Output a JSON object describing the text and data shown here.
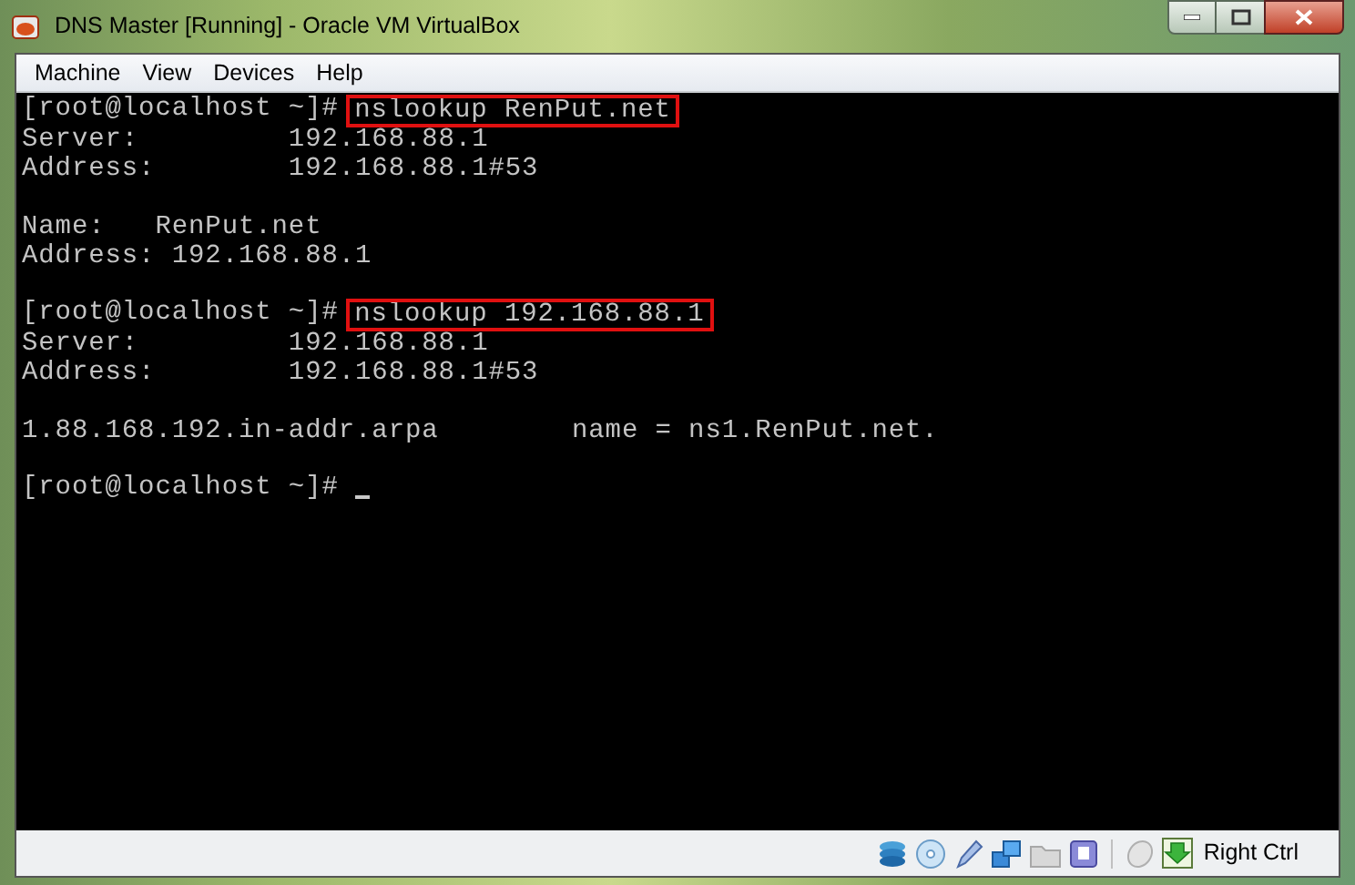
{
  "window": {
    "title": "DNS Master [Running] - Oracle VM VirtualBox"
  },
  "menu": [
    "Machine",
    "View",
    "Devices",
    "Help"
  ],
  "terminal": {
    "blocks": [
      [
        {
          "kind": "prompt",
          "prompt": "[root@localhost ~]#",
          "command": "nslookup RenPut.net",
          "highlighted": true,
          "cursor": false
        },
        {
          "kind": "output",
          "text": "Server:         192.168.88.1"
        },
        {
          "kind": "output",
          "text": "Address:        192.168.88.1#53"
        }
      ],
      [
        {
          "kind": "output",
          "text": "Name:   RenPut.net"
        },
        {
          "kind": "output",
          "text": "Address: 192.168.88.1"
        }
      ],
      [
        {
          "kind": "prompt",
          "prompt": "[root@localhost ~]#",
          "command": "nslookup 192.168.88.1",
          "highlighted": true,
          "cursor": false
        },
        {
          "kind": "output",
          "text": "Server:         192.168.88.1"
        },
        {
          "kind": "output",
          "text": "Address:        192.168.88.1#53"
        }
      ],
      [
        {
          "kind": "output",
          "text": "1.88.168.192.in-addr.arpa        name = ns1.RenPut.net."
        }
      ],
      [
        {
          "kind": "prompt",
          "prompt": "[root@localhost ~]#",
          "cursor": true
        }
      ]
    ]
  },
  "status_bar": {
    "host_key": "Right Ctrl"
  }
}
